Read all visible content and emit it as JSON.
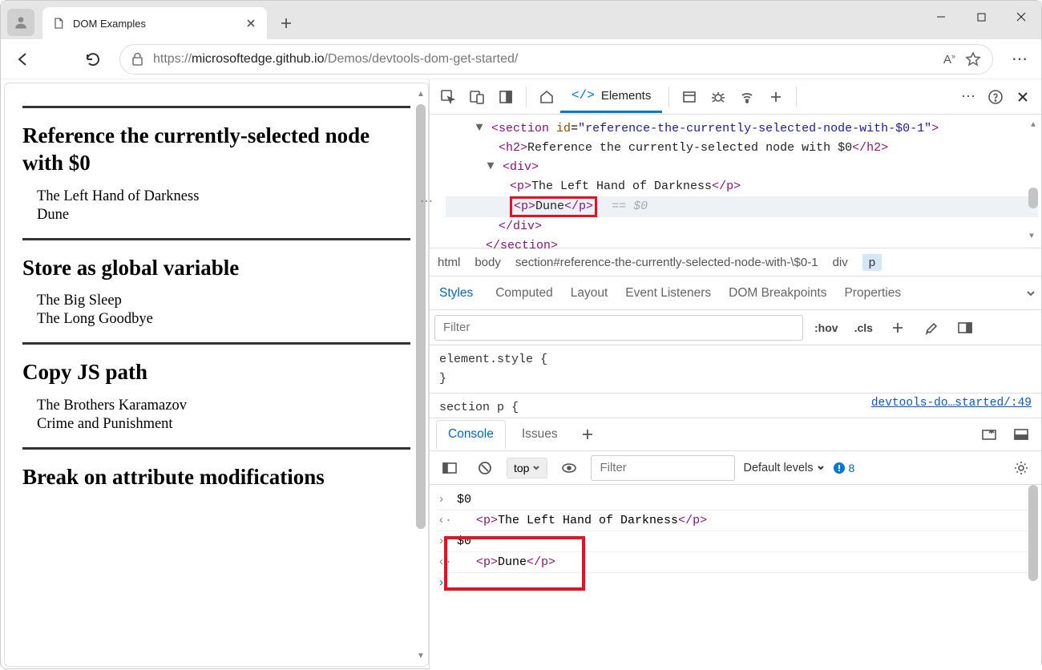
{
  "window": {
    "tab_title": "DOM Examples"
  },
  "toolbar": {
    "url_prefix": "https://",
    "url_host": "microsoftedge.github.io",
    "url_path": "/Demos/devtools-dom-get-started/"
  },
  "page": {
    "sections": [
      {
        "h": "Reference the currently-selected node with $0",
        "items": [
          "The Left Hand of Darkness",
          "Dune"
        ]
      },
      {
        "h": "Store as global variable",
        "items": [
          "The Big Sleep",
          "The Long Goodbye"
        ]
      },
      {
        "h": "Copy JS path",
        "items": [
          "The Brothers Karamazov",
          "Crime and Punishment"
        ]
      },
      {
        "h": "Break on attribute modifications",
        "items": []
      }
    ]
  },
  "devtools": {
    "elements_tab": "Elements",
    "dom": {
      "section_open": "<section id=\"reference-the-currently-selected-node-with-$0-1\">",
      "h2": "<h2>Reference the currently-selected node with $0</h2>",
      "div_open": "<div>",
      "p1": "<p>The Left Hand of Darkness</p>",
      "p2": "<p>Dune</p>",
      "eq0": "== $0",
      "div_close": "</div>",
      "section_close": "</section>"
    },
    "breadcrumbs": [
      "html",
      "body",
      "section#reference-the-currently-selected-node-with-\\$0-1",
      "div",
      "p"
    ],
    "styles_tabs": [
      "Styles",
      "Computed",
      "Layout",
      "Event Listeners",
      "DOM Breakpoints",
      "Properties"
    ],
    "filter_placeholder": "Filter",
    "hov": ":hov",
    "cls": ".cls",
    "rules": {
      "element_style": "element.style {",
      "close": "}",
      "section_p": "section p {",
      "link": "devtools-do…started/:49"
    },
    "drawer": {
      "console": "Console",
      "issues": "Issues"
    },
    "console": {
      "top": "top",
      "filter_placeholder": "Filter",
      "levels": "Default levels",
      "badge": "8",
      "rows": [
        {
          "kind": "in",
          "text": "$0"
        },
        {
          "kind": "out",
          "html": "<p>The Left Hand of Darkness</p>"
        },
        {
          "kind": "in",
          "text": "$0"
        },
        {
          "kind": "out",
          "html": "<p>Dune</p>"
        }
      ]
    }
  }
}
